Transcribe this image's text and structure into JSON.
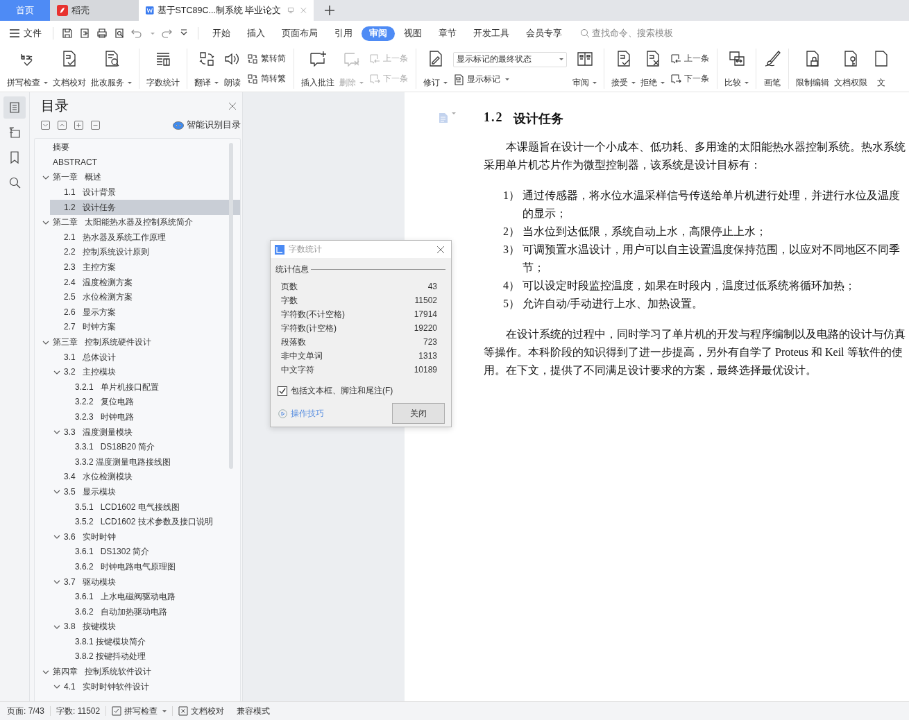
{
  "tabs": [
    {
      "label": "首页",
      "kind": "home",
      "selected": false
    },
    {
      "label": "稻壳",
      "kind": "app",
      "selected": false
    },
    {
      "label": "基于STC89C...制系统 毕业论文",
      "kind": "doc",
      "selected": true
    }
  ],
  "menu": {
    "file": "文件",
    "tabs": [
      {
        "label": "开始",
        "selected": false
      },
      {
        "label": "插入",
        "selected": false
      },
      {
        "label": "页面布局",
        "selected": false
      },
      {
        "label": "引用",
        "selected": false
      },
      {
        "label": "审阅",
        "selected": true
      },
      {
        "label": "视图",
        "selected": false
      },
      {
        "label": "章节",
        "selected": false
      },
      {
        "label": "开发工具",
        "selected": false
      },
      {
        "label": "会员专享",
        "selected": false
      }
    ],
    "search": {
      "placeholder": "查找命令、搜索模板"
    }
  },
  "ribbon": {
    "groups": [
      [
        {
          "kind": "big",
          "label": "拼写检查",
          "dropdown": true,
          "disabled": false
        },
        {
          "kind": "big",
          "label": "文档校对",
          "dropdown": false,
          "disabled": false
        },
        {
          "kind": "big",
          "label": "批改服务",
          "dropdown": true,
          "disabled": false
        }
      ],
      [
        {
          "kind": "big",
          "label": "字数统计",
          "dropdown": false,
          "disabled": false
        }
      ],
      [
        {
          "kind": "big",
          "label": "翻译",
          "dropdown": true,
          "disabled": false
        },
        {
          "kind": "big",
          "label": "朗读",
          "dropdown": false,
          "disabled": false
        },
        {
          "kind": "stack",
          "items": [
            {
              "label": "繁转简",
              "disabled": false
            },
            {
              "label": "简转繁",
              "disabled": false
            }
          ]
        }
      ],
      [
        {
          "kind": "big",
          "label": "插入批注",
          "dropdown": false,
          "disabled": false
        },
        {
          "kind": "big",
          "label": "删除",
          "dropdown": true,
          "disabled": true
        },
        {
          "kind": "stack",
          "items": [
            {
              "label": "上一条",
              "disabled": true
            },
            {
              "label": "下一条",
              "disabled": true
            }
          ]
        }
      ],
      [
        {
          "kind": "big",
          "label": "修订",
          "dropdown": true,
          "disabled": false
        },
        {
          "kind": "select",
          "value": "显示标记的最终状态",
          "sub": {
            "label": "显示标记",
            "dropdown": true
          }
        },
        {
          "kind": "big",
          "label": "审阅",
          "dropdown": true,
          "disabled": false
        }
      ],
      [
        {
          "kind": "big",
          "label": "接受",
          "dropdown": true,
          "disabled": false
        },
        {
          "kind": "big",
          "label": "拒绝",
          "dropdown": true,
          "disabled": false
        },
        {
          "kind": "stack",
          "items": [
            {
              "label": "上一条",
              "disabled": false
            },
            {
              "label": "下一条",
              "disabled": false
            }
          ]
        }
      ],
      [
        {
          "kind": "big",
          "label": "比较",
          "dropdown": true,
          "disabled": false
        }
      ],
      [
        {
          "kind": "big",
          "label": "画笔",
          "dropdown": false,
          "disabled": false
        }
      ],
      [
        {
          "kind": "big",
          "label": "限制编辑",
          "dropdown": false,
          "disabled": false
        },
        {
          "kind": "big",
          "label": "文档权限",
          "dropdown": false,
          "disabled": false
        },
        {
          "kind": "big",
          "label": "文",
          "dropdown": false,
          "disabled": false
        }
      ]
    ]
  },
  "side_tabs": [
    {
      "selected": true
    },
    {
      "selected": false
    },
    {
      "selected": false
    },
    {
      "selected": false
    }
  ],
  "toc": {
    "title": "目录",
    "smart_button": "智能识别目录",
    "items": [
      {
        "label": "摘要",
        "selected": false
      },
      {
        "label": "ABSTRACT",
        "selected": false
      },
      {
        "label": "第一章   概述",
        "selected": false,
        "expanded": true,
        "children": [
          {
            "label": "1.1   设计背景",
            "selected": false
          },
          {
            "label": "1.2   设计任务",
            "selected": true
          }
        ]
      },
      {
        "label": "第二章   太阳能热水器及控制系统简介",
        "selected": false,
        "expanded": true,
        "children": [
          {
            "label": "2.1   热水器及系统工作原理",
            "selected": false
          },
          {
            "label": "2.2   控制系统设计原则",
            "selected": false
          },
          {
            "label": "2.3   主控方案",
            "selected": false
          },
          {
            "label": "2.4   温度检测方案",
            "selected": false
          },
          {
            "label": "2.5   水位检测方案",
            "selected": false
          },
          {
            "label": "2.6   显示方案",
            "selected": false
          },
          {
            "label": "2.7   时钟方案",
            "selected": false
          }
        ]
      },
      {
        "label": "第三章   控制系统硬件设计",
        "selected": false,
        "expanded": true,
        "children": [
          {
            "label": "3.1   总体设计",
            "selected": false
          },
          {
            "label": "3.2   主控模块",
            "selected": false,
            "expanded": true,
            "children": [
              {
                "label": "3.2.1   单片机接口配置",
                "selected": false
              },
              {
                "label": "3.2.2   复位电路",
                "selected": false
              },
              {
                "label": "3.2.3   时钟电路",
                "selected": false
              }
            ]
          },
          {
            "label": "3.3   温度测量模块",
            "selected": false,
            "expanded": true,
            "children": [
              {
                "label": "3.3.1   DS18B20 简介",
                "selected": false
              },
              {
                "label": "3.3.2 温度测量电路接线图",
                "selected": false
              }
            ]
          },
          {
            "label": "3.4   水位检测模块",
            "selected": false
          },
          {
            "label": "3.5   显示模块",
            "selected": false,
            "expanded": true,
            "children": [
              {
                "label": "3.5.1   LCD1602 电气接线图",
                "selected": false
              },
              {
                "label": "3.5.2   LCD1602 技术参数及接口说明",
                "selected": false
              }
            ]
          },
          {
            "label": "3.6   实时时钟",
            "selected": false,
            "expanded": true,
            "children": [
              {
                "label": "3.6.1   DS1302 简介",
                "selected": false
              },
              {
                "label": "3.6.2   时钟电路电气原理图",
                "selected": false
              }
            ]
          },
          {
            "label": "3.7   驱动模块",
            "selected": false,
            "expanded": true,
            "children": [
              {
                "label": "3.6.1   上水电磁阀驱动电路",
                "selected": false
              },
              {
                "label": "3.6.2   自动加热驱动电路",
                "selected": false
              }
            ]
          },
          {
            "label": "3.8   按键模块",
            "selected": false,
            "expanded": true,
            "children": [
              {
                "label": "3.8.1 按键模块简介",
                "selected": false
              },
              {
                "label": "3.8.2 按键抖动处理",
                "selected": false
              }
            ]
          }
        ]
      },
      {
        "label": "第四章   控制系统软件设计",
        "selected": false,
        "expanded": true,
        "children": [
          {
            "label": "4.1   实时时钟软件设计",
            "selected": false,
            "expanded": true
          }
        ]
      }
    ]
  },
  "document": {
    "heading": {
      "number": "1.2",
      "title": "设计任务"
    },
    "blocks": [
      {
        "kind": "paragraph",
        "text": "本课题旨在设计一个小成本、低功耗、多用途的太阳能热水器控制系统。热水系统采用单片机芯片作为微型控制器，该系统是设计目标有："
      },
      {
        "kind": "list",
        "items": [
          {
            "number": "1）",
            "text": "通过传感器，将水位水温采样信号传送给单片机进行处理，并进行水位及温度的显示；"
          },
          {
            "number": "2）",
            "text": "当水位到达低限，系统自动上水，高限停止上水；"
          },
          {
            "number": "3）",
            "text": "可调预置水温设计，用户可以自主设置温度保持范围，以应对不同地区不同季节；"
          },
          {
            "number": "4）",
            "text": "可以设定时段监控温度，如果在时段内，温度过低系统将循环加热；"
          },
          {
            "number": "5）",
            "text": "允许自动/手动进行上水、加热设置。"
          }
        ]
      },
      {
        "kind": "paragraph",
        "text": "在设计系统的过程中，同时学习了单片机的开发与程序编制以及电路的设计与仿真等操作。本科阶段的知识得到了进一步提高，另外有自学了 Proteus 和 Keil 等软件的使用。在下文，提供了不同满足设计要求的方案，最终选择最优设计。"
      }
    ]
  },
  "dialog": {
    "title": "字数统计",
    "section": "统计信息",
    "stats": [
      {
        "label": "页数",
        "value": "43"
      },
      {
        "label": "字数",
        "value": "11502"
      },
      {
        "label": "字符数(不计空格)",
        "value": "17914"
      },
      {
        "label": "字符数(计空格)",
        "value": "19220"
      },
      {
        "label": "段落数",
        "value": "723"
      },
      {
        "label": "非中文单词",
        "value": "1313"
      },
      {
        "label": "中文字符",
        "value": "10189"
      }
    ],
    "include_checkbox": {
      "label": "包括文本框、脚注和尾注(F)",
      "checked": true
    },
    "tips_link": "操作技巧",
    "close_button": "关闭"
  },
  "status_bar": {
    "page": "页面: 7/43",
    "words": "字数: 11502",
    "spell_check": "拼写检查",
    "proofread": "文档校对",
    "mode": "兼容模式"
  }
}
